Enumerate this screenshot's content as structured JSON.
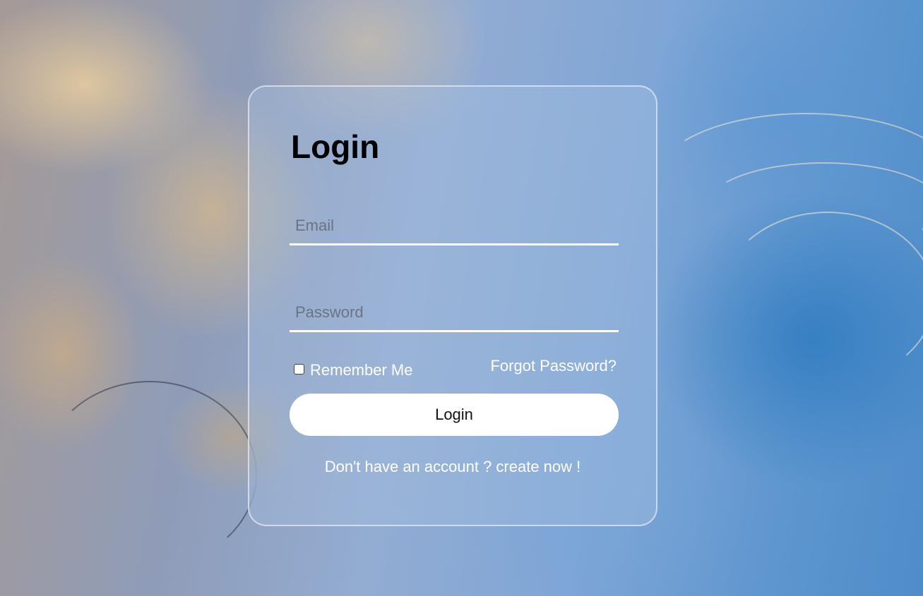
{
  "login": {
    "title": "Login",
    "email_placeholder": "Email",
    "email_value": "",
    "password_placeholder": "Password",
    "password_value": "",
    "remember_label": "Remember Me",
    "remember_checked": false,
    "forgot_label": "Forgot Password?",
    "submit_label": "Login",
    "signup_text": "Don't have an account ? create now !"
  },
  "colors": {
    "card_border": "#ffffff",
    "button_bg": "#ffffff",
    "text_light": "#ffffff",
    "title_text": "#000000"
  }
}
